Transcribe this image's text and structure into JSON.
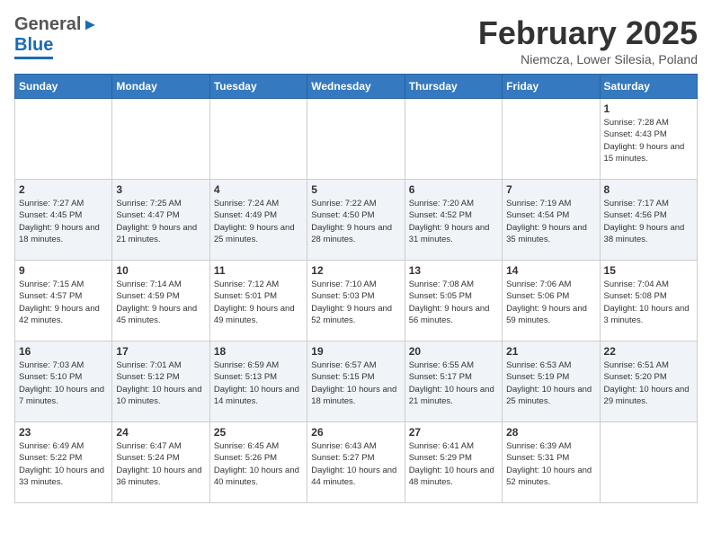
{
  "header": {
    "logo_general": "General",
    "logo_blue": "Blue",
    "month_title": "February 2025",
    "location": "Niemcza, Lower Silesia, Poland"
  },
  "days_of_week": [
    "Sunday",
    "Monday",
    "Tuesday",
    "Wednesday",
    "Thursday",
    "Friday",
    "Saturday"
  ],
  "weeks": [
    [
      {
        "day": "",
        "info": ""
      },
      {
        "day": "",
        "info": ""
      },
      {
        "day": "",
        "info": ""
      },
      {
        "day": "",
        "info": ""
      },
      {
        "day": "",
        "info": ""
      },
      {
        "day": "",
        "info": ""
      },
      {
        "day": "1",
        "info": "Sunrise: 7:28 AM\nSunset: 4:43 PM\nDaylight: 9 hours and 15 minutes."
      }
    ],
    [
      {
        "day": "2",
        "info": "Sunrise: 7:27 AM\nSunset: 4:45 PM\nDaylight: 9 hours and 18 minutes."
      },
      {
        "day": "3",
        "info": "Sunrise: 7:25 AM\nSunset: 4:47 PM\nDaylight: 9 hours and 21 minutes."
      },
      {
        "day": "4",
        "info": "Sunrise: 7:24 AM\nSunset: 4:49 PM\nDaylight: 9 hours and 25 minutes."
      },
      {
        "day": "5",
        "info": "Sunrise: 7:22 AM\nSunset: 4:50 PM\nDaylight: 9 hours and 28 minutes."
      },
      {
        "day": "6",
        "info": "Sunrise: 7:20 AM\nSunset: 4:52 PM\nDaylight: 9 hours and 31 minutes."
      },
      {
        "day": "7",
        "info": "Sunrise: 7:19 AM\nSunset: 4:54 PM\nDaylight: 9 hours and 35 minutes."
      },
      {
        "day": "8",
        "info": "Sunrise: 7:17 AM\nSunset: 4:56 PM\nDaylight: 9 hours and 38 minutes."
      }
    ],
    [
      {
        "day": "9",
        "info": "Sunrise: 7:15 AM\nSunset: 4:57 PM\nDaylight: 9 hours and 42 minutes."
      },
      {
        "day": "10",
        "info": "Sunrise: 7:14 AM\nSunset: 4:59 PM\nDaylight: 9 hours and 45 minutes."
      },
      {
        "day": "11",
        "info": "Sunrise: 7:12 AM\nSunset: 5:01 PM\nDaylight: 9 hours and 49 minutes."
      },
      {
        "day": "12",
        "info": "Sunrise: 7:10 AM\nSunset: 5:03 PM\nDaylight: 9 hours and 52 minutes."
      },
      {
        "day": "13",
        "info": "Sunrise: 7:08 AM\nSunset: 5:05 PM\nDaylight: 9 hours and 56 minutes."
      },
      {
        "day": "14",
        "info": "Sunrise: 7:06 AM\nSunset: 5:06 PM\nDaylight: 9 hours and 59 minutes."
      },
      {
        "day": "15",
        "info": "Sunrise: 7:04 AM\nSunset: 5:08 PM\nDaylight: 10 hours and 3 minutes."
      }
    ],
    [
      {
        "day": "16",
        "info": "Sunrise: 7:03 AM\nSunset: 5:10 PM\nDaylight: 10 hours and 7 minutes."
      },
      {
        "day": "17",
        "info": "Sunrise: 7:01 AM\nSunset: 5:12 PM\nDaylight: 10 hours and 10 minutes."
      },
      {
        "day": "18",
        "info": "Sunrise: 6:59 AM\nSunset: 5:13 PM\nDaylight: 10 hours and 14 minutes."
      },
      {
        "day": "19",
        "info": "Sunrise: 6:57 AM\nSunset: 5:15 PM\nDaylight: 10 hours and 18 minutes."
      },
      {
        "day": "20",
        "info": "Sunrise: 6:55 AM\nSunset: 5:17 PM\nDaylight: 10 hours and 21 minutes."
      },
      {
        "day": "21",
        "info": "Sunrise: 6:53 AM\nSunset: 5:19 PM\nDaylight: 10 hours and 25 minutes."
      },
      {
        "day": "22",
        "info": "Sunrise: 6:51 AM\nSunset: 5:20 PM\nDaylight: 10 hours and 29 minutes."
      }
    ],
    [
      {
        "day": "23",
        "info": "Sunrise: 6:49 AM\nSunset: 5:22 PM\nDaylight: 10 hours and 33 minutes."
      },
      {
        "day": "24",
        "info": "Sunrise: 6:47 AM\nSunset: 5:24 PM\nDaylight: 10 hours and 36 minutes."
      },
      {
        "day": "25",
        "info": "Sunrise: 6:45 AM\nSunset: 5:26 PM\nDaylight: 10 hours and 40 minutes."
      },
      {
        "day": "26",
        "info": "Sunrise: 6:43 AM\nSunset: 5:27 PM\nDaylight: 10 hours and 44 minutes."
      },
      {
        "day": "27",
        "info": "Sunrise: 6:41 AM\nSunset: 5:29 PM\nDaylight: 10 hours and 48 minutes."
      },
      {
        "day": "28",
        "info": "Sunrise: 6:39 AM\nSunset: 5:31 PM\nDaylight: 10 hours and 52 minutes."
      },
      {
        "day": "",
        "info": ""
      }
    ]
  ]
}
